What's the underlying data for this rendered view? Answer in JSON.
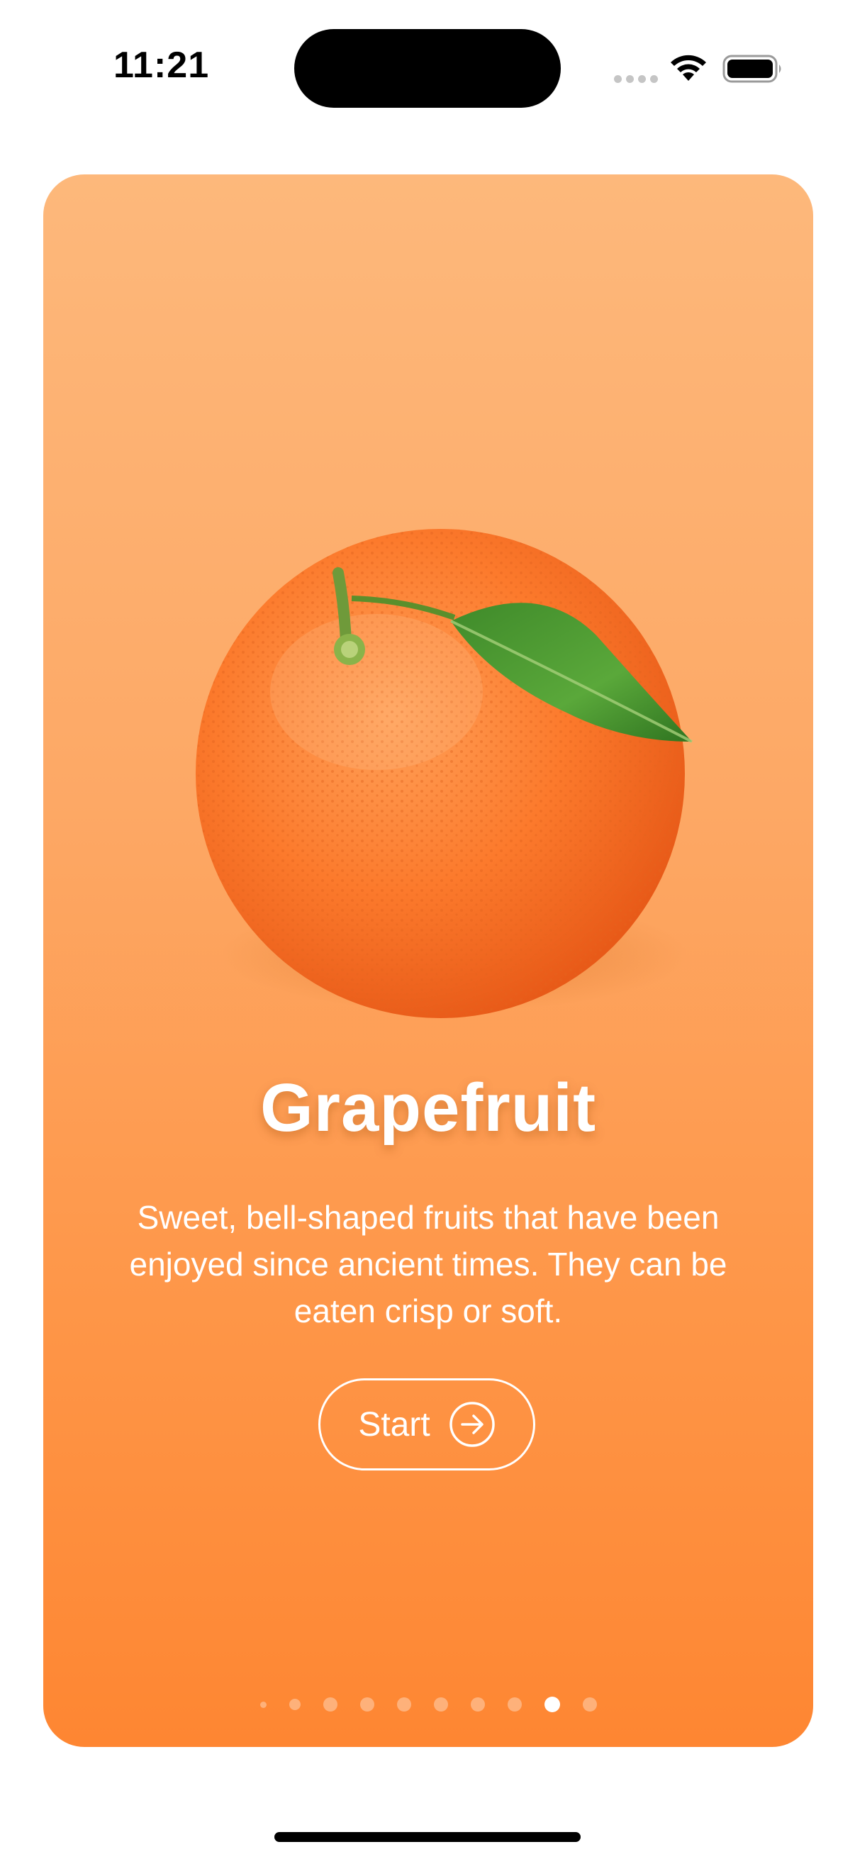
{
  "status_bar": {
    "time": "11:21"
  },
  "card": {
    "title": "Grapefruit",
    "description": "Sweet, bell-shaped fruits that have been enjoyed since ancient times. They can be eaten crisp or soft.",
    "start_button_label": "Start",
    "image_name": "grapefruit-image",
    "page_indicator": {
      "total_pages": 10,
      "current_page_index": 8
    }
  },
  "colors": {
    "card_gradient_top": "#fdb87b",
    "card_gradient_bottom": "#fe8632",
    "text": "#ffffff"
  }
}
